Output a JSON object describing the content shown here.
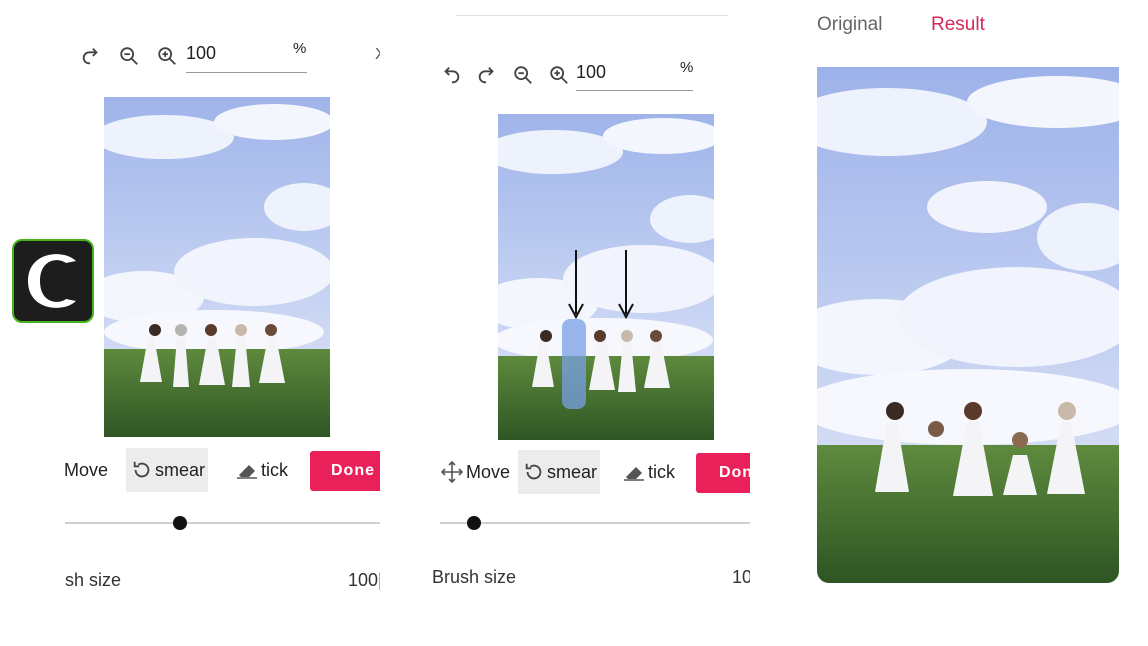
{
  "colors": {
    "accent": "#e9205a",
    "logo_bg": "#1d1d1d",
    "logo_border": "#47b41f",
    "sky": "#b9c8ef",
    "grass": "#3f6b2c"
  },
  "panel1": {
    "icons": [
      "redo-icon",
      "zoom-out-icon",
      "zoom-in-icon"
    ],
    "zoom_value": "100",
    "zoom_unit": "%",
    "clip_edge": "X",
    "tools": {
      "move": "Move",
      "smear": "smear",
      "tick": "tick"
    },
    "done": "Done",
    "brush_label": "sh size",
    "brush_value": "100|",
    "brush_level": 0.36
  },
  "panel2": {
    "icons": [
      "undo-icon",
      "redo-icon",
      "zoom-out-icon",
      "zoom-in-icon"
    ],
    "zoom_value": "100",
    "zoom_unit": "%",
    "tools": {
      "move": "Move",
      "smear": "smear",
      "tick": "tick"
    },
    "done": "Don",
    "brush_label": "Brush size",
    "brush_value": "10",
    "brush_level": 0.11
  },
  "panel3": {
    "tabs": {
      "original": "Original",
      "result": "Result"
    }
  },
  "logo": {
    "icon": "c-logo-icon"
  }
}
